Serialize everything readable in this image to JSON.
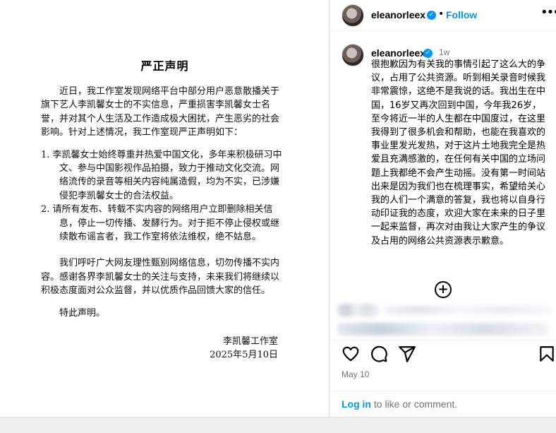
{
  "document": {
    "title": "严正声明",
    "paragraph1": "近日，我工作室发现网络平台中部分用户恶意散播关于旗下艺人李凯馨女士的不实信息，严重损害李凯馨女士名誉，并对其个人生活及工作造成极大困扰，产生恶劣的社会影响。针对上述情况，我工作室现严正声明如下：",
    "item1": "1. 李凯馨女士始终尊重并热爱中国文化，多年来积极研习中文、参与中国影视作品拍摄，致力于推动文化交流。网络流传的录音等相关内容纯属造假，均为不实，已涉嫌侵犯李凯馨女士的合法权益。",
    "item2": "2. 请所有发布、转载不实内容的网络用户立即删除相关信息，停止一切传播、发酵行为。对于拒不停止侵权或继续散布谣言者，我工作室将依法维权，绝不姑息。",
    "paragraph2": "我们呼吁广大网友理性甄别网络信息，切勿传播不实内容。感谢各界李凯馨女士的关注与支持，未来我们将继续以积极态度面对公众监督，并以优质作品回馈大家的信任。",
    "closing": "特此声明。",
    "signature": "李凯馨工作室",
    "date": "2025年5月10日"
  },
  "header": {
    "username": "eleanorleex",
    "verified_mark": "✓",
    "separator": "•",
    "follow_label": "Follow",
    "more_icon": "•••"
  },
  "comment": {
    "username": "eleanorleex",
    "time": "1w",
    "text": "很抱歉因为有关我的事情引起了这么大的争议，占用了公共资源。听到相关录音时候我非常震惊，这绝不是我说的话。我出生在中国，16岁又再次回到中国，今年我26岁，至今将近一半的人生都在中国度过，在这里我得到了很多机会和帮助，也能在我喜欢的事业里发光发热，对于这片土地我完全是热爱且充满感激的，在任何有关中国的立场问题上我都绝不会产生动摇。没有第一时间站出来是因为我们也在梳理事实，希望给关心我的人们一个满意的答复，我也将以自身行动印证我的态度，欢迎大家在未来的日子里一起来监督，再次对由我让大家产生的争议及占用的网络公共资源表示歉意。"
  },
  "load_more_icon": "+",
  "post_date": "May 10",
  "login": {
    "link_label": "Log in",
    "suffix": " to like or comment."
  },
  "colors": {
    "accent": "#0095f6",
    "muted": "#737373",
    "divider": "#efefef"
  },
  "icons": [
    "heart-icon",
    "comment-icon",
    "share-icon",
    "bookmark-icon",
    "more-icon",
    "verified-badge-icon",
    "load-more-icon"
  ]
}
